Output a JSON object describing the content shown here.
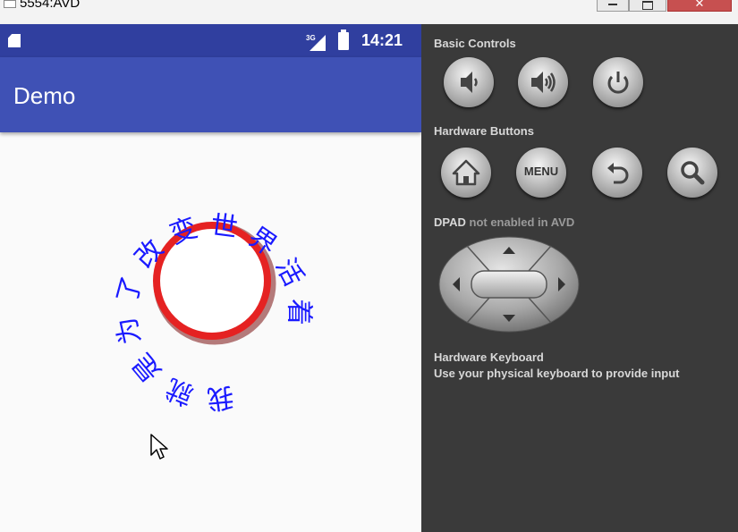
{
  "window": {
    "title": "5554:AVD"
  },
  "status_bar": {
    "network": "3G",
    "time": "14:21"
  },
  "app": {
    "title": "Demo"
  },
  "circle_text": {
    "characters": [
      "我",
      "就",
      "是",
      "为",
      "了",
      "改",
      "变",
      "世",
      "界",
      "活",
      "着"
    ],
    "color": "#1a1aff",
    "ring_color": "#e52222"
  },
  "controls": {
    "basic_controls_label": "Basic Controls",
    "hardware_buttons_label": "Hardware Buttons",
    "menu_label": "MENU",
    "dpad_label": "DPAD",
    "dpad_note": "not enabled in AVD",
    "keyboard_label": "Hardware Keyboard",
    "keyboard_note": "Use your physical keyboard to provide input"
  },
  "icons": [
    "sd-card-icon",
    "signal-icon",
    "battery-icon",
    "volume-down-icon",
    "volume-up-icon",
    "power-icon",
    "home-icon",
    "back-icon",
    "search-icon",
    "cursor-icon"
  ]
}
